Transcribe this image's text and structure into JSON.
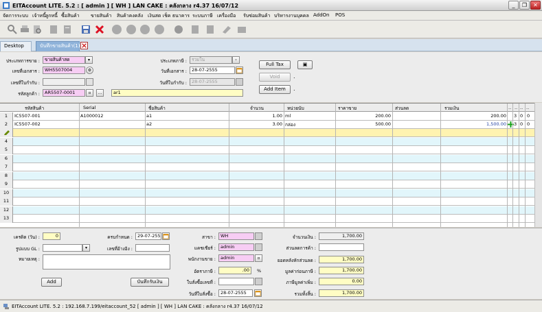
{
  "window": {
    "title": "EITAccount LITE. 5.2 : [ admin ] [ WH ]      LAN CAKE : คลังกลาง     r4.37 16/07/12",
    "minimize": "_",
    "restore": "❐",
    "close": "✕"
  },
  "menu": [
    "จัดการระบบ",
    "เจ้าหนี้",
    "ลูกหนี้",
    "ซื้อสินค้า",
    "ขายสินค้า",
    "สินค้าคงคลัง",
    "เงินสด เช็ค ธนาคาร",
    "ระบบภาษี",
    "เครื่องมือ",
    "รับซ่อมสินค้า",
    "บริหารงานบุคคล",
    "AddOn",
    "POS"
  ],
  "tabs": {
    "desktop": "Desktop",
    "doc": "บันทึกขายสินค้า(1)"
  },
  "form": {
    "sale_type_label": "ประเภทการขาย :",
    "sale_type_value": "ขายสินค้าสด",
    "doc_no_label": "เลขที่เอกสาร :",
    "doc_no_value": "WH5507004",
    "ref_no_label": "เลขที่ใบกำกับ :",
    "ref_no_value": "",
    "customer_label": "รหัสลูกค้า :",
    "customer_value": "AR5507-0001",
    "customer_name": "ar1",
    "tax_type_label": "ประเภทภาษี :",
    "tax_type_value": "รวมใน",
    "doc_date_label": "วันที่เอกสาร :",
    "doc_date_value": "28-07-2555",
    "invoice_date_label": "วันที่ใบกำกับ :",
    "invoice_date_value": "28-07-2555",
    "full_tax": "Full Tax",
    "void": "Void",
    "add_item": "Add Item",
    "dot": "."
  },
  "grid": {
    "headers": [
      "รหัสสินค้า",
      "Serial",
      "ชื่อสินค้า",
      "จำนวน",
      "หน่วยนับ",
      "ราคาขาย",
      "ส่วนลด",
      "รวมเงิน",
      "..",
      "..",
      "..",
      ".."
    ],
    "rows": [
      {
        "num": "1",
        "code": "IC5507-001",
        "serial": "A1000012",
        "name": "a1",
        "qty": "1.00",
        "unit": "ml",
        "price": "200.00",
        "discount": "",
        "total": "200.00",
        "c1": "3",
        "c2": "0",
        "c3": "0"
      },
      {
        "num": "2",
        "code": "IC5507-002",
        "serial": "",
        "name": "a2",
        "qty": "3.00",
        "unit": "กล่อง",
        "price": "500.00",
        "discount": "",
        "total": "1,500.00",
        "c1": "3",
        "c2": "0",
        "c3": "0"
      }
    ],
    "empty_row_numbers": [
      "4",
      "5",
      "6",
      "7",
      "8",
      "9",
      "10",
      "11",
      "12",
      "13"
    ]
  },
  "bottom": {
    "credit_label": "เครดิต (วัน) :",
    "credit_value": "0",
    "due_label": "ครบกำหนด :",
    "due_value": "29-07-2555",
    "gl_label": "รูปแบบ GL :",
    "ref_doc_label": "เลขที่อ้างอิง :",
    "remark_label": "หมายเหตุ :",
    "add_button": "Add",
    "receive_button": "บันทึกรับเงิน",
    "branch_label": "สาขา :",
    "branch_value": "WH",
    "cashier_label": "แคชเชียร์ :",
    "cashier_value": "admin",
    "salesman_label": "พนักงานขาย :",
    "salesman_value": "admin",
    "tax_rate_label": "อัตราภาษี :",
    "tax_rate_value": ".00",
    "percent": "%",
    "po_no_label": "ใบสั่งซื้อเลขที่ :",
    "po_date_label": "วันที่ใบสั่งซื้อ :",
    "po_date_value": "28-07-2555",
    "amount_label": "จำนวนเงิน :",
    "amount_value": "1,700.00",
    "bill_discount_label": "ส่วนลดการค้า :",
    "bill_discount_value": "",
    "after_discount_label": "ยอดหลังหักส่วนลด :",
    "after_discount_value": "1,700.00",
    "before_vat_label": "มูลค่าก่อนภาษี :",
    "before_vat_value": "1,700.00",
    "vat_label": "ภาษีมูลค่าเพิ่ม :",
    "vat_value": "0.00",
    "net_label": "รวมทั้งสิ้น :",
    "net_value": "1,700.00"
  },
  "status": "EITAccount LITE. 5.2 : 192.168.7.199/eitaccount_52  [ admin ] [ WH ]      LAN CAKE : คลังกลาง     r4.37 16/07/12"
}
